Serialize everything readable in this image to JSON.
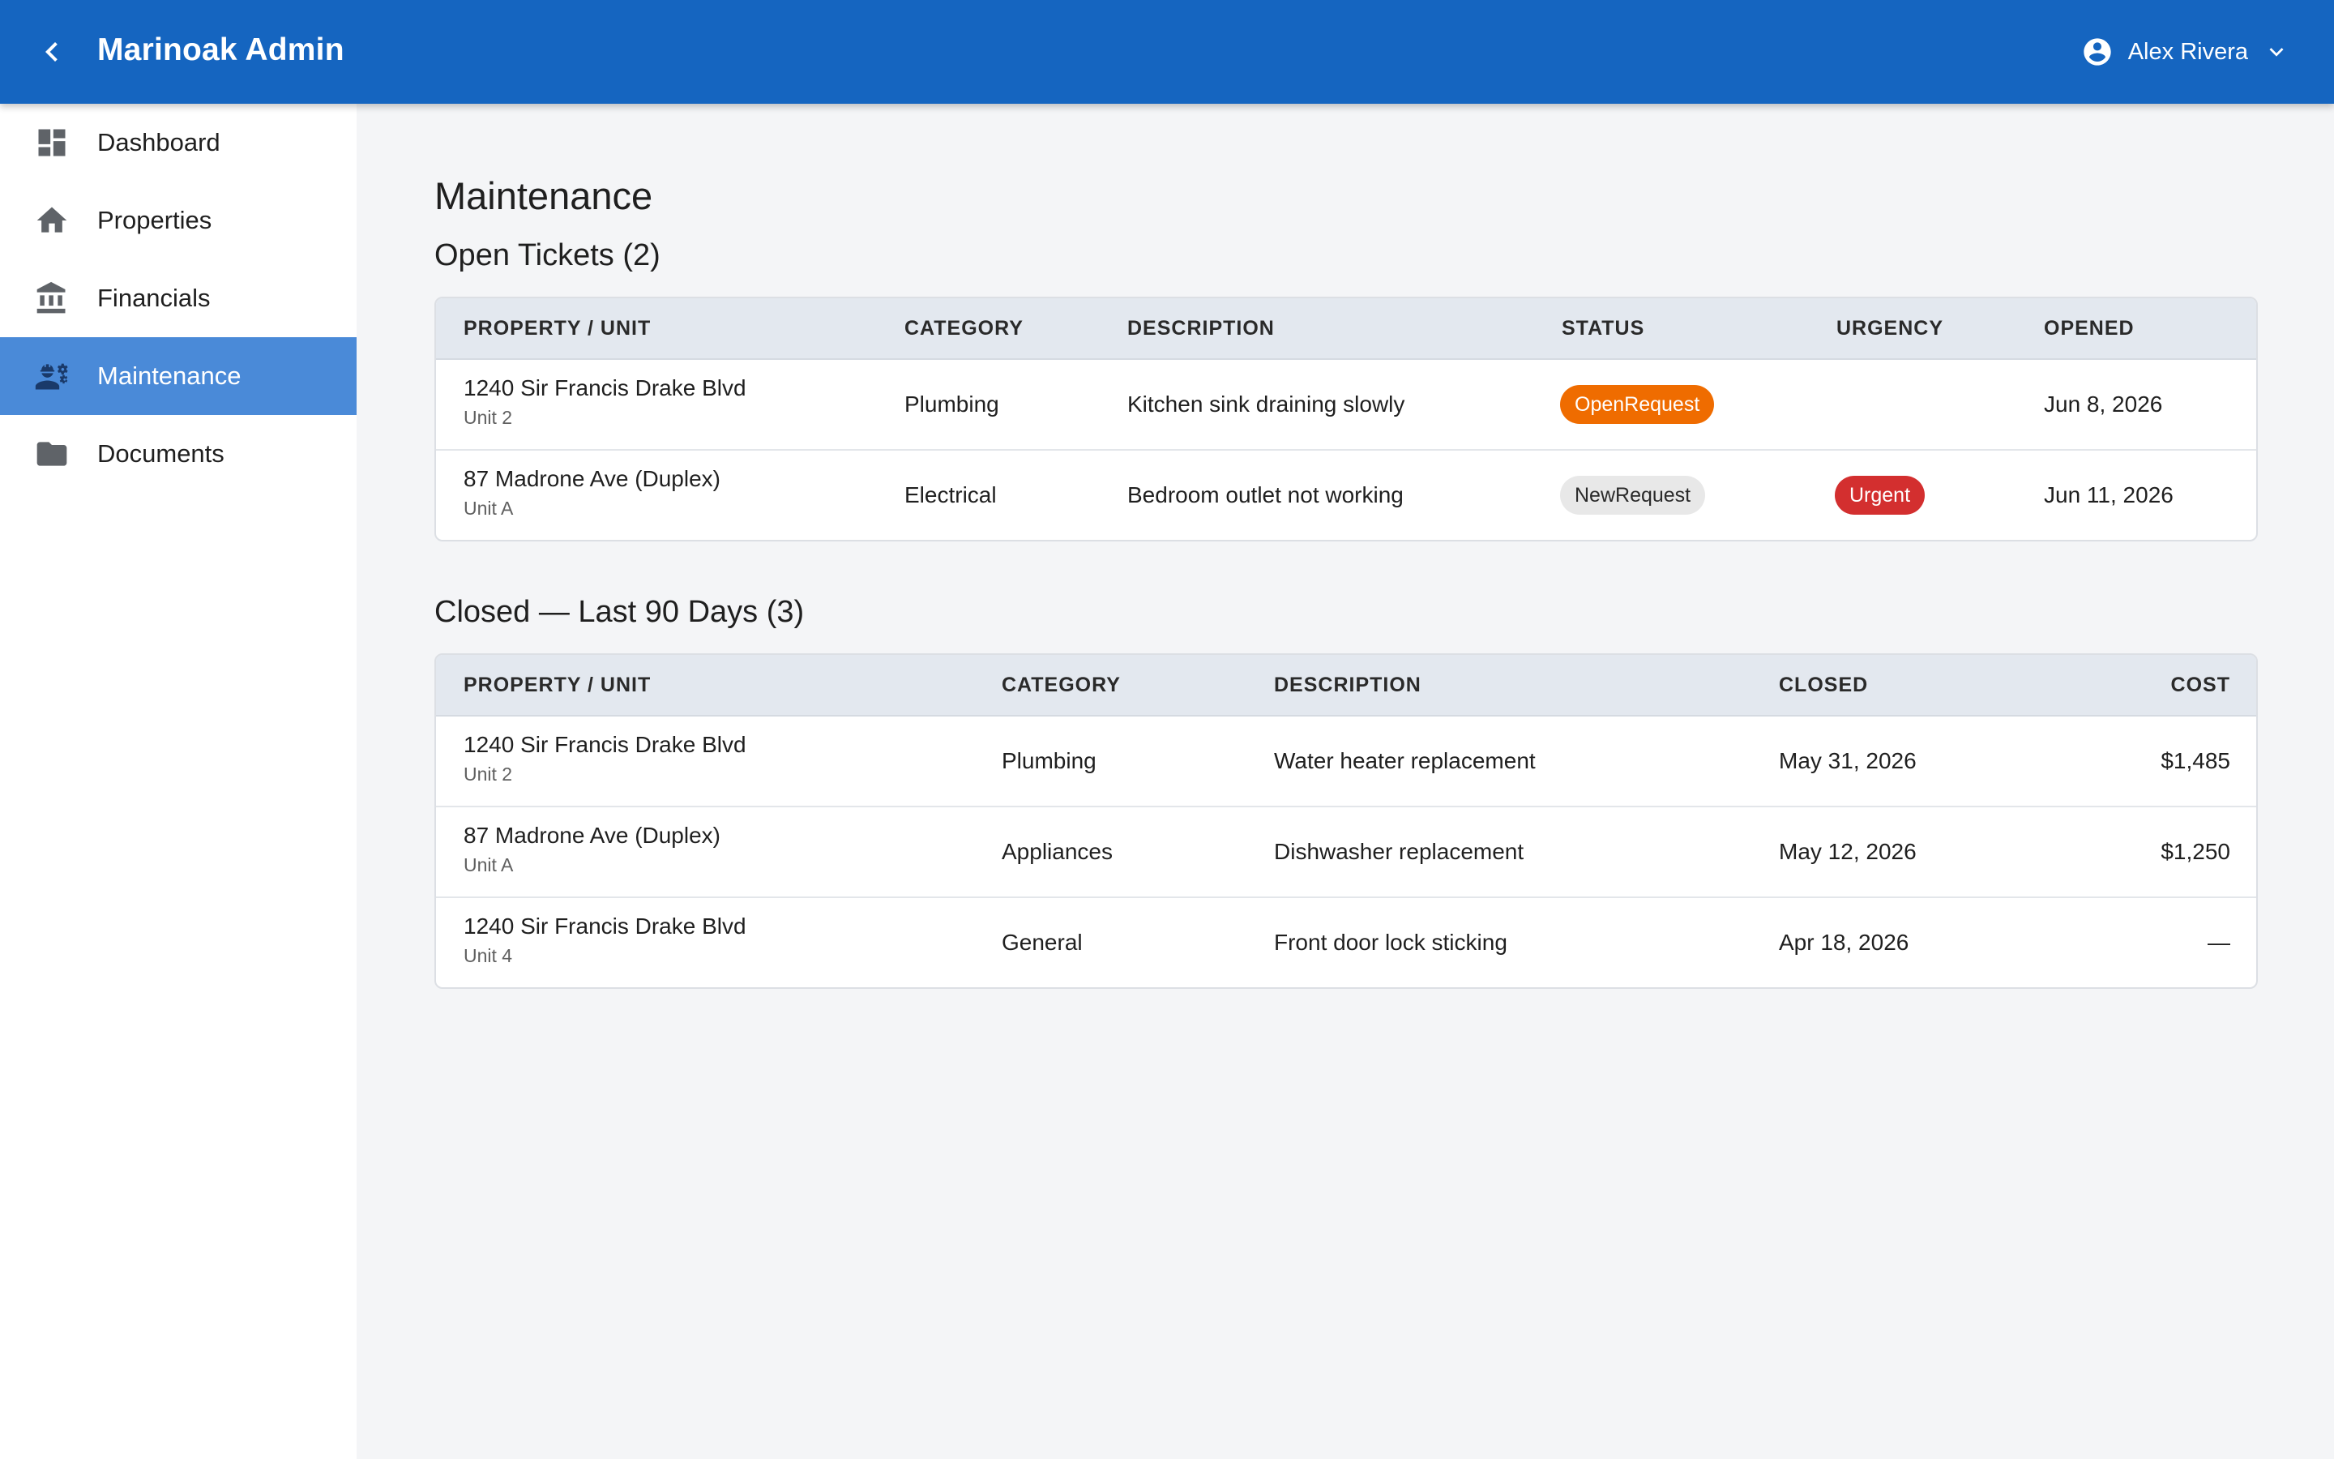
{
  "app": {
    "title": "Marinoak Admin",
    "user_name": "Alex Rivera",
    "accent_color": "#1565c0"
  },
  "sidebar": {
    "items": [
      {
        "label": "Dashboard",
        "icon": "dashboard-icon",
        "active": false
      },
      {
        "label": "Properties",
        "icon": "home-icon",
        "active": false
      },
      {
        "label": "Financials",
        "icon": "bank-icon",
        "active": false
      },
      {
        "label": "Maintenance",
        "icon": "engineering-icon",
        "active": true
      },
      {
        "label": "Documents",
        "icon": "folder-icon",
        "active": false
      }
    ]
  },
  "main": {
    "page_title": "Maintenance",
    "open_section": {
      "title": "Open Tickets (2)",
      "headers": [
        "PROPERTY / UNIT",
        "CATEGORY",
        "DESCRIPTION",
        "STATUS",
        "URGENCY",
        "OPENED"
      ],
      "rows": [
        {
          "property": "1240 Sir Francis Drake Blvd",
          "unit": "Unit 2",
          "category": "Plumbing",
          "description": "Kitchen sink draining slowly",
          "status": "OpenRequest",
          "urgency": "",
          "opened": "Jun 8, 2026"
        },
        {
          "property": "87 Madrone Ave (Duplex)",
          "unit": "Unit A",
          "category": "Electrical",
          "description": "Bedroom outlet not working",
          "status": "NewRequest",
          "urgency": "Urgent",
          "opened": "Jun 11, 2026"
        }
      ]
    },
    "closed_section": {
      "title": "Closed — Last 90 Days (3)",
      "headers": [
        "PROPERTY / UNIT",
        "CATEGORY",
        "DESCRIPTION",
        "CLOSED",
        "COST"
      ],
      "rows": [
        {
          "property": "1240 Sir Francis Drake Blvd",
          "unit": "Unit 2",
          "category": "Plumbing",
          "description": "Water heater replacement",
          "closed": "May 31, 2026",
          "cost": "$1,485"
        },
        {
          "property": "87 Madrone Ave (Duplex)",
          "unit": "Unit A",
          "category": "Appliances",
          "description": "Dishwasher replacement",
          "closed": "May 12, 2026",
          "cost": "$1,250"
        },
        {
          "property": "1240 Sir Francis Drake Blvd",
          "unit": "Unit 4",
          "category": "General",
          "description": "Front door lock sticking",
          "closed": "Apr 18, 2026",
          "cost": "—"
        }
      ]
    }
  },
  "colors": {
    "status_open": "#ef6c00",
    "status_new": "#e8e8e8",
    "urgency_urgent": "#d32f2f",
    "sidebar_active": "#4a8ad8"
  }
}
